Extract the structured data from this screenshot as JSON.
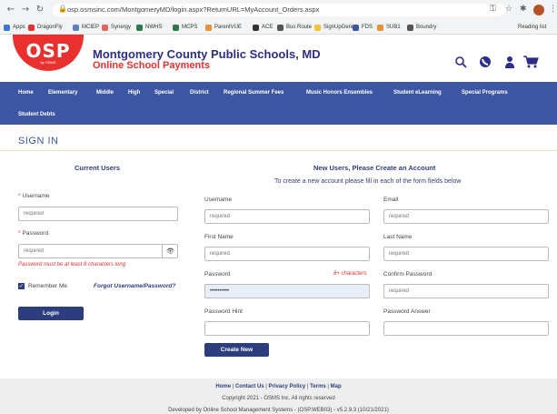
{
  "browser": {
    "url": "osp.osmsinc.com/MontgomeryMD/login.aspx?ReturnURL=MyAccount_Orders.aspx",
    "bookmarks": [
      {
        "label": "Apps",
        "color": "#3c78d8"
      },
      {
        "label": "DragonFly",
        "color": "#e8312f"
      },
      {
        "label": "MCIEP",
        "color": "#5b7fbf"
      },
      {
        "label": "Synergy",
        "color": "#e06666"
      },
      {
        "label": "NWHS",
        "color": "#2d7a4a"
      },
      {
        "label": "MCPS",
        "color": "#2d7a4a"
      },
      {
        "label": "ParentVUE",
        "color": "#e69138"
      },
      {
        "label": "ACE",
        "color": "#333333"
      },
      {
        "label": "Bus Route",
        "color": "#555555"
      },
      {
        "label": "SignUpGenius",
        "color": "#f1c232"
      },
      {
        "label": "FDS",
        "color": "#3d56a4"
      },
      {
        "label": "SUB1",
        "color": "#e69138"
      },
      {
        "label": "Boundry",
        "color": "#555555"
      }
    ],
    "reading_list": "Reading list"
  },
  "header": {
    "logo_text": "OSP",
    "logo_sub": "by OSMS",
    "school_name": "Montgomery County Public Schools, MD",
    "school_sub": "Online School Payments"
  },
  "nav": {
    "items": [
      "Home",
      "Elementary",
      "Middle",
      "High",
      "Special",
      "District",
      "Regional Summer Fees",
      "Music Honors Ensembles",
      "Student eLearning",
      "Special Programs",
      "Student Debts"
    ]
  },
  "signin": {
    "title": "SIGN IN",
    "current": {
      "heading": "Current Users",
      "username_label": "Username",
      "username_placeholder": "required",
      "password_label": "Password",
      "password_placeholder": "required",
      "password_error": "Password must be at least 8 characters long",
      "remember_label": "Remember Me",
      "forgot_link": "Forgot Username/Password?",
      "login_button": "Login"
    },
    "new": {
      "heading": "New Users, Please Create an Account",
      "subheading": "To create a new account please fill in each of the form fields below",
      "username_label": "Username",
      "username_placeholder": "required",
      "email_label": "Email",
      "email_placeholder": "required",
      "first_label": "First Name",
      "first_placeholder": "required",
      "last_label": "Last Name",
      "last_placeholder": "required",
      "password_label": "Password",
      "password_hint_text": "8+ characters",
      "password_value": "••••••••••",
      "confirm_label": "Confirm Password",
      "confirm_placeholder": "required",
      "hint_label": "Password Hint",
      "answer_label": "Password Answer",
      "create_button": "Create New"
    }
  },
  "footer": {
    "links": [
      "Home",
      "Contact Us",
      "Privacy Policy",
      "Terms",
      "Map"
    ],
    "copyright": "Copyright 2021 - OSMS Inc. All rights reserved",
    "developed": "Developed by Online School Management Systems - (OSP.WEB03) - v5.2.9.3 (10/21/2021)"
  }
}
